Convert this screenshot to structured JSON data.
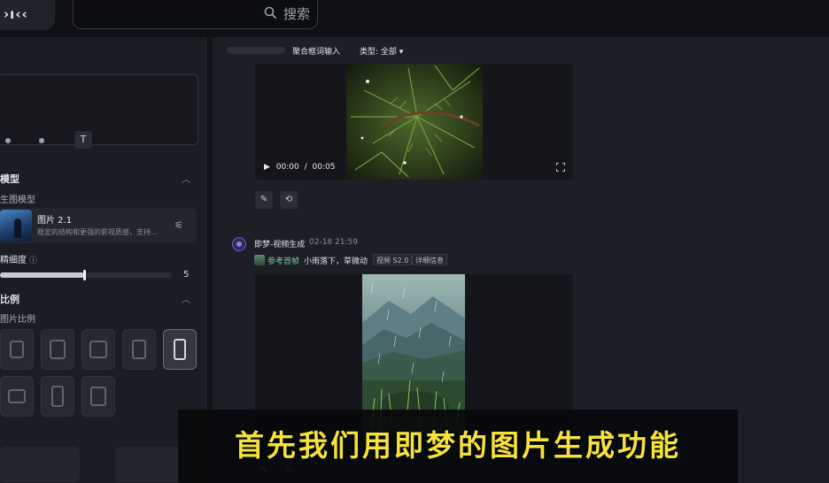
{
  "app": {
    "logo_text": "›ı‹‹"
  },
  "search": {
    "placeholder": "搜索"
  },
  "left_panel": {
    "model_section": {
      "title": "模型",
      "subtitle": "生图模型",
      "model": {
        "name": "图片 2.1",
        "description": "稳定的结构和更强的影视质感，支持..."
      }
    },
    "precision": {
      "label": "精细度",
      "value": "5",
      "fraction": 0.49
    },
    "ratio_section": {
      "title": "比例",
      "subtitle": "图片比例",
      "selected_index": 4
    }
  },
  "filter_bar": {
    "items": [
      {
        "label": "聚合框词输入"
      },
      {
        "label": "类型: 全部 ▾"
      }
    ]
  },
  "feed": {
    "item1": {
      "time_current": "00:00",
      "time_separator": "/",
      "time_total": "00:05"
    },
    "item2": {
      "author": "即梦-视频生成",
      "date": "02-18  21:59",
      "ref_label": "参考首帧",
      "prompt": "小雨落下，草微动",
      "tags": [
        "视频 S2.0",
        "详细信息"
      ]
    }
  },
  "subtitle": {
    "text": "首先我们用即梦的图片生成功能"
  },
  "icons": {
    "search": "search-icon",
    "text_tool": "text-tool-icon",
    "settings": "sliders-icon",
    "edit": "pencil-icon",
    "regenerate": "loop-icon",
    "play": "play-icon",
    "fullscreen": "fullscreen-icon"
  },
  "colors": {
    "subtitle": "#f5e23c",
    "accent": "#8b7cff",
    "ref_label": "#77c9a2"
  }
}
